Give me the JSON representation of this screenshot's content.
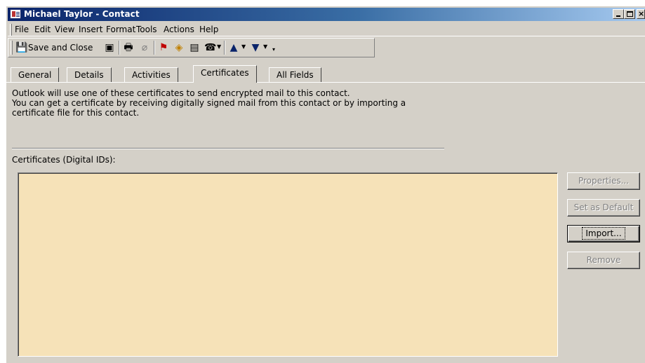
{
  "window": {
    "title": "Michael Taylor - Contact"
  },
  "menu": [
    "File",
    "Edit",
    "View",
    "Insert",
    "Format",
    "Tools",
    "Actions",
    "Help"
  ],
  "toolbar": {
    "save_close_label": "Save and Close"
  },
  "tabs": [
    "General",
    "Details",
    "Activities",
    "Certificates",
    "All Fields"
  ],
  "active_tab": "Certificates",
  "content": {
    "info_line1": "Outlook will use one of these certificates to send encrypted mail to this contact.",
    "info_line2": "You can get a certificate by receiving digitally signed mail from this contact or by importing a",
    "info_line3": "certificate file for this contact.",
    "cert_list_label": "Certificates (Digital IDs):",
    "certificates": []
  },
  "buttons": {
    "properties": "Properties...",
    "set_default": "Set as Default",
    "import": "Import...",
    "remove": "Remove"
  },
  "colors": {
    "list_background": "#f6e2b8",
    "title_start": "#0a246a",
    "title_end": "#a6caf0"
  }
}
